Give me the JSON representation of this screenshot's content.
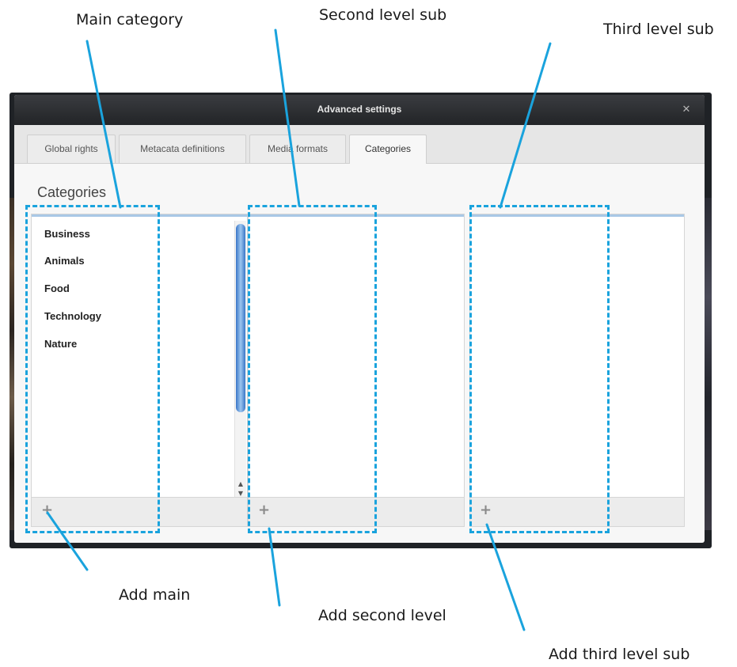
{
  "annotations": {
    "main_category": "Main category",
    "second_level_sub": "Second level sub",
    "third_level_sub": "Third level sub",
    "add_main": "Add main",
    "add_second_level": "Add second level",
    "add_third_level_sub": "Add third level sub"
  },
  "dialog": {
    "title": "Advanced settings",
    "close_icon": "close-icon",
    "tabs": [
      {
        "label": "Global rights",
        "active": false
      },
      {
        "label": "Metacata definitions",
        "active": false
      },
      {
        "label": "Media formats",
        "active": false
      },
      {
        "label": "Categories",
        "active": true
      }
    ],
    "heading": "Categories",
    "main_categories": [
      "Business",
      "Animals",
      "Food",
      "Technology",
      "Nature"
    ],
    "add_icon": "plus-icon"
  },
  "colors": {
    "annotation_blue": "#1aa3dd",
    "titlebar": "#222427",
    "scrollbar_blue": "#3a76c8"
  }
}
